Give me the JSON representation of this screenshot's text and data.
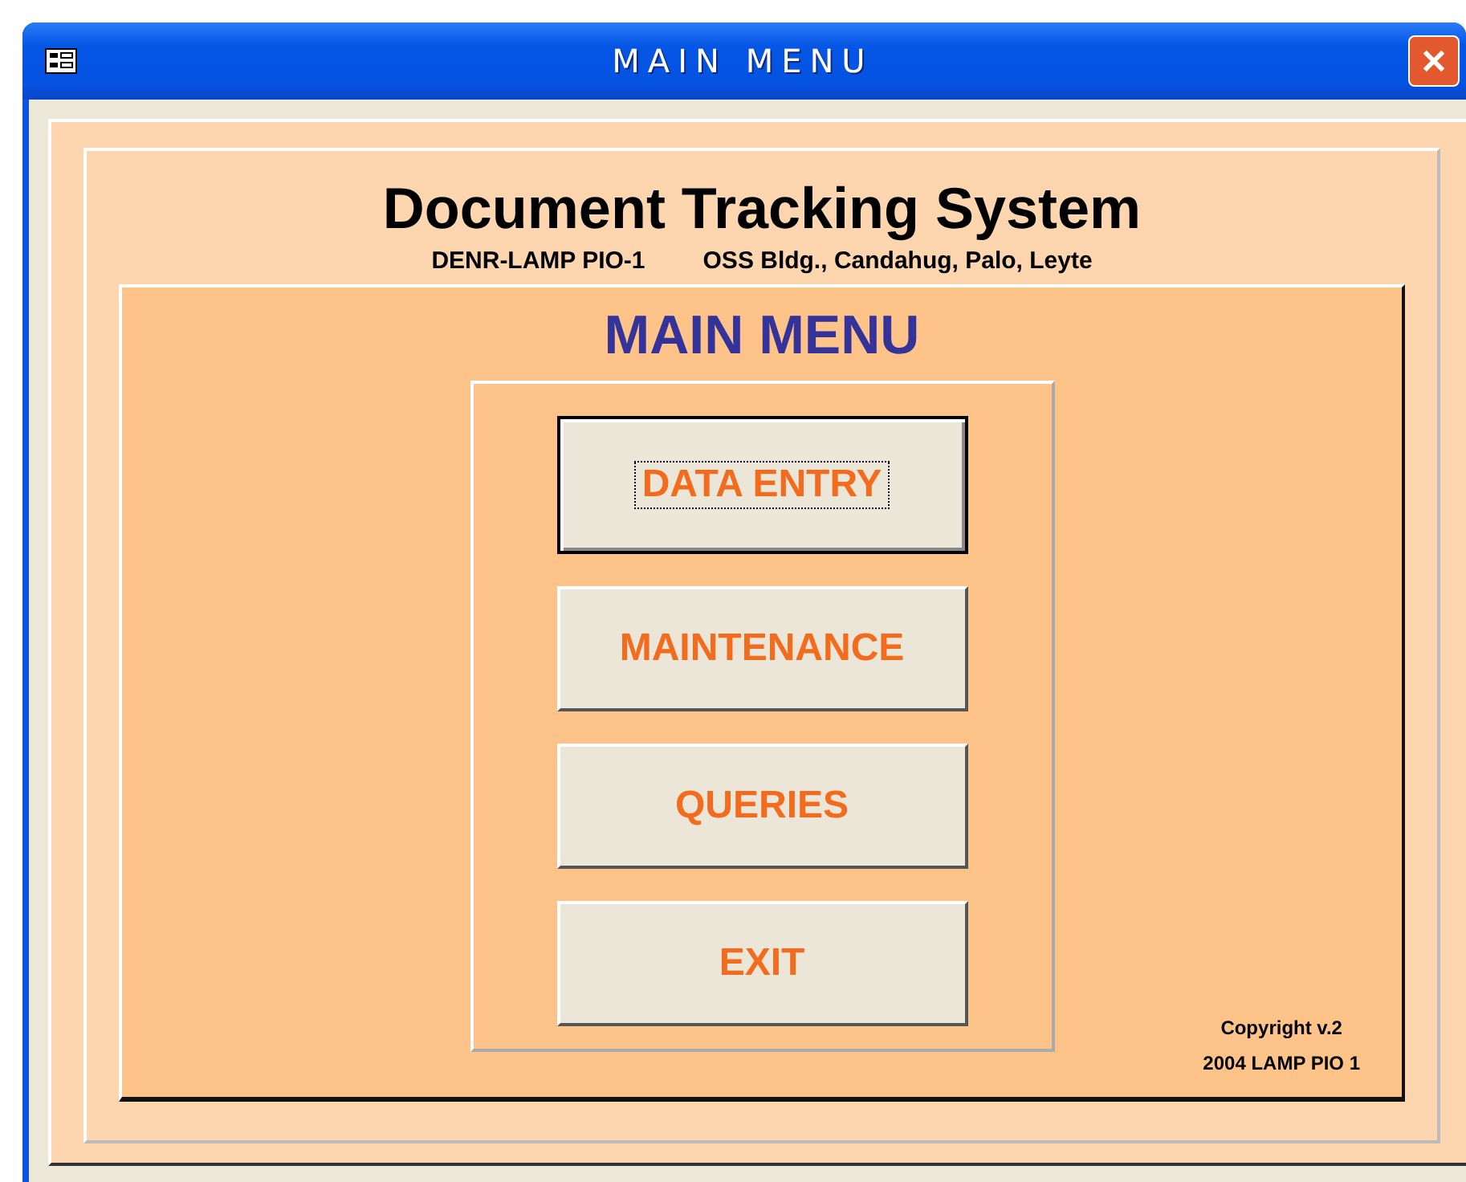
{
  "window": {
    "title": "MAIN MENU"
  },
  "header": {
    "title": "Document Tracking System",
    "office": "DENR-LAMP PIO-1",
    "address": "OSS Bldg., Candahug, Palo, Leyte"
  },
  "menu": {
    "title": "MAIN MENU",
    "buttons": [
      {
        "label": "DATA ENTRY",
        "focused": true
      },
      {
        "label": "MAINTENANCE",
        "focused": false
      },
      {
        "label": "QUERIES",
        "focused": false
      },
      {
        "label": "EXIT",
        "focused": false
      }
    ]
  },
  "copyright": [
    "Copyright v.2",
    "2004 LAMP PIO 1"
  ]
}
